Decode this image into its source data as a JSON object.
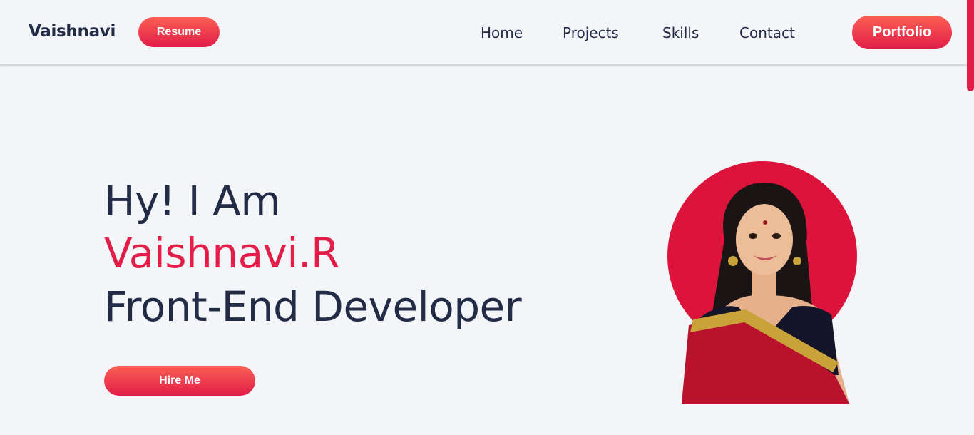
{
  "header": {
    "brand": "Vaishnavi",
    "resume_label": "Resume",
    "nav": [
      "Home",
      "Projects",
      "Skills",
      "Contact"
    ],
    "portfolio_label": "Portfolio"
  },
  "hero": {
    "greeting": "Hy! I Am",
    "name": "Vaishnavi.R",
    "role": "Front-End Developer",
    "hire_label": "Hire Me"
  },
  "colors": {
    "accent": "#e11d48",
    "text": "#222c47",
    "background": "#f4f5f9"
  },
  "icons": {
    "portrait": "profile-photo"
  }
}
